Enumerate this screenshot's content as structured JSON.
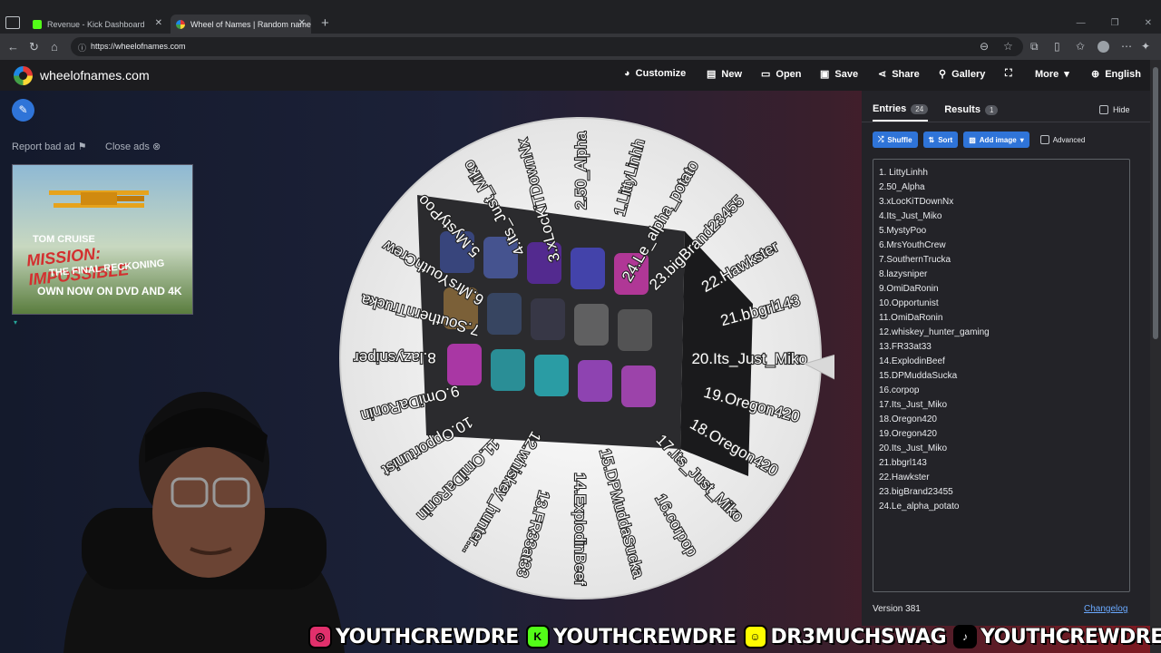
{
  "browser": {
    "tabs": [
      {
        "title": "Revenue - Kick Dashboard",
        "favicon_color": "#53fc18"
      },
      {
        "title": "Wheel of Names | Random name",
        "favicon_color": "#e53935"
      }
    ],
    "url": "https://wheelofnames.com"
  },
  "header": {
    "brand": "wheelofnames.com",
    "menu": {
      "customize": "Customize",
      "new": "New",
      "open": "Open",
      "save": "Save",
      "share": "Share",
      "gallery": "Gallery",
      "fullscreen": "",
      "more": "More",
      "language": "English"
    }
  },
  "ads": {
    "report": "Report bad ad",
    "close": "Close ads",
    "banner": {
      "line1": "TOM CRUISE",
      "line2": "MISSION: IMPOSSIBLE",
      "line3": "THE FINAL RECKONING",
      "line4": "OWN NOW ON DVD AND 4K"
    }
  },
  "panel": {
    "tabs": [
      {
        "label": "Entries",
        "count": "24"
      },
      {
        "label": "Results",
        "count": "1"
      }
    ],
    "hide": "Hide",
    "buttons": {
      "shuffle": "Shuffle",
      "sort": "Sort",
      "add_image": "Add image",
      "advanced": "Advanced"
    },
    "entries": [
      "1. LittyLinhh",
      "2.50_Alpha",
      "3.xLocKiTDownNx",
      "4.Its_Just_Miko",
      "5.MystyPoo",
      "6.MrsYouthCrew",
      "7.SouthernTrucka",
      "8.lazysniper",
      "9.OmiDaRonin",
      "10.Opportunist",
      "11.OmiDaRonin",
      "12.whiskey_hunter_gaming",
      "13.FR33at33",
      "14.ExplodinBeef",
      "15.DPMuddaSucka",
      "16.corpop",
      "17.Its_Just_Miko",
      "18.Oregon420",
      "19.Oregon420",
      "20.Its_Just_Miko",
      "21.bbgrl143",
      "22.Hawkster",
      "23.bigBrand23455",
      "24.Le_alpha_potato"
    ],
    "version": "Version 381",
    "changelog": "Changelog"
  },
  "wheel": {
    "labels": [
      "1.LittyLinhh",
      "2.50_Alpha",
      "3.xLocKiTDownNx",
      "4.Its_Just_Miko",
      "5.MystyPoo",
      "6.MrsYouthCrew",
      "7.SouthernTrucka",
      "8.lazysniper",
      "9.OmiDaRonin",
      "10.Opportunist",
      "11.OmiDaRonin",
      "12.whiskey_hunter...",
      "13.FR33at33",
      "14.ExplodinBeef",
      "15.DPMuddaSucka",
      "16.corpop",
      "17.Its_Just_Miko",
      "18.Oregon420",
      "19.Oregon420",
      "20.Its_Just_Miko",
      "21.bbgrl143",
      "22.Hawkster",
      "23.bigBrand23455",
      "24.Le_alpha_potato"
    ]
  },
  "socials": [
    {
      "icon": "instagram-icon",
      "handle": "YOUTHCREWDRE",
      "color": "#e1306c"
    },
    {
      "icon": "kick-icon",
      "handle": "YOUTHCREWDRE",
      "color": "#53fc18"
    },
    {
      "icon": "snapchat-icon",
      "handle": "DR3MUCHSWAG",
      "color": "#fffc00"
    },
    {
      "icon": "tiktok-icon",
      "handle": "YOUTHCREWDRE",
      "color": "#000000"
    }
  ]
}
